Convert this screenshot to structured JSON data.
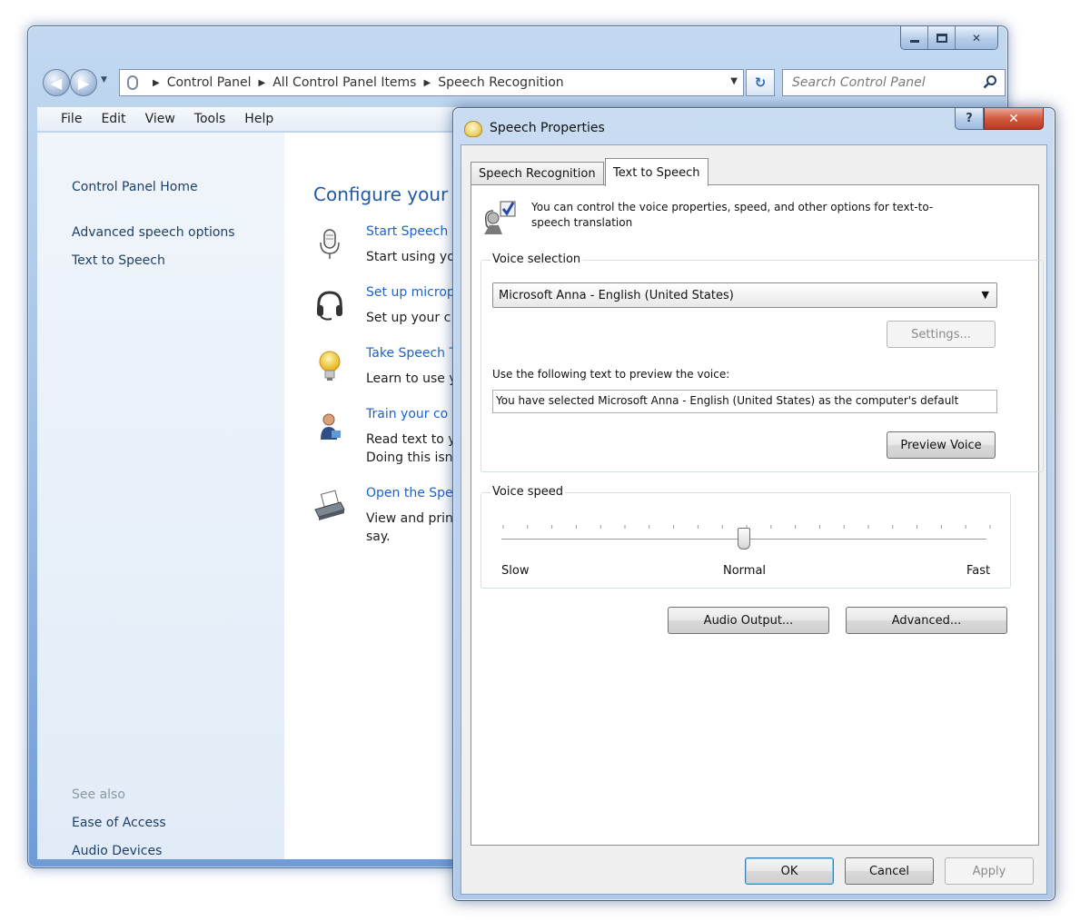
{
  "explorer": {
    "address_bar": {
      "crumbs": [
        "Control Panel",
        "All Control Panel Items",
        "Speech Recognition"
      ]
    },
    "search": {
      "placeholder": "Search Control Panel"
    },
    "menu": [
      "File",
      "Edit",
      "View",
      "Tools",
      "Help"
    ],
    "left_pane": {
      "home_link": "Control Panel Home",
      "links": [
        "Advanced speech options",
        "Text to Speech"
      ],
      "see_also_label": "See also",
      "see_also_links": [
        "Ease of Access",
        "Audio Devices"
      ]
    },
    "main": {
      "title": "Configure your S",
      "tasks": [
        {
          "link": "Start Speech R",
          "desc": [
            "Start using yo"
          ],
          "icon": "microphone-icon"
        },
        {
          "link": "Set up microp",
          "desc": [
            "Set up your c"
          ],
          "icon": "headset-icon"
        },
        {
          "link": "Take Speech T",
          "desc": [
            "Learn to use y"
          ],
          "icon": "lightbulb-icon"
        },
        {
          "link": "Train your co",
          "desc": [
            "Read text to y",
            "Doing this isn"
          ],
          "icon": "user-icon"
        },
        {
          "link": "Open the Spe",
          "desc": [
            "View and prin",
            "say."
          ],
          "icon": "printer-icon"
        }
      ]
    }
  },
  "dialog": {
    "title": "Speech Properties",
    "help_glyph": "?",
    "close_glyph": "✕",
    "tabs": [
      "Speech Recognition",
      "Text to Speech"
    ],
    "active_tab": "Text to Speech",
    "intro": "You can control the voice properties, speed, and other options for text-to-speech translation",
    "voice_selection": {
      "group_label": "Voice selection",
      "selected_voice": "Microsoft Anna - English (United States)",
      "settings_label": "Settings...",
      "preview_label": "Use the following text to preview the voice:",
      "preview_text": "You have selected Microsoft Anna - English (United States) as the computer's default",
      "preview_button": "Preview Voice"
    },
    "voice_speed": {
      "group_label": "Voice speed",
      "slow_label": "Slow",
      "normal_label": "Normal",
      "fast_label": "Fast",
      "value_fraction": 0.5
    },
    "audio_output_label": "Audio Output...",
    "advanced_label": "Advanced...",
    "ok_label": "OK",
    "cancel_label": "Cancel",
    "apply_label": "Apply"
  }
}
